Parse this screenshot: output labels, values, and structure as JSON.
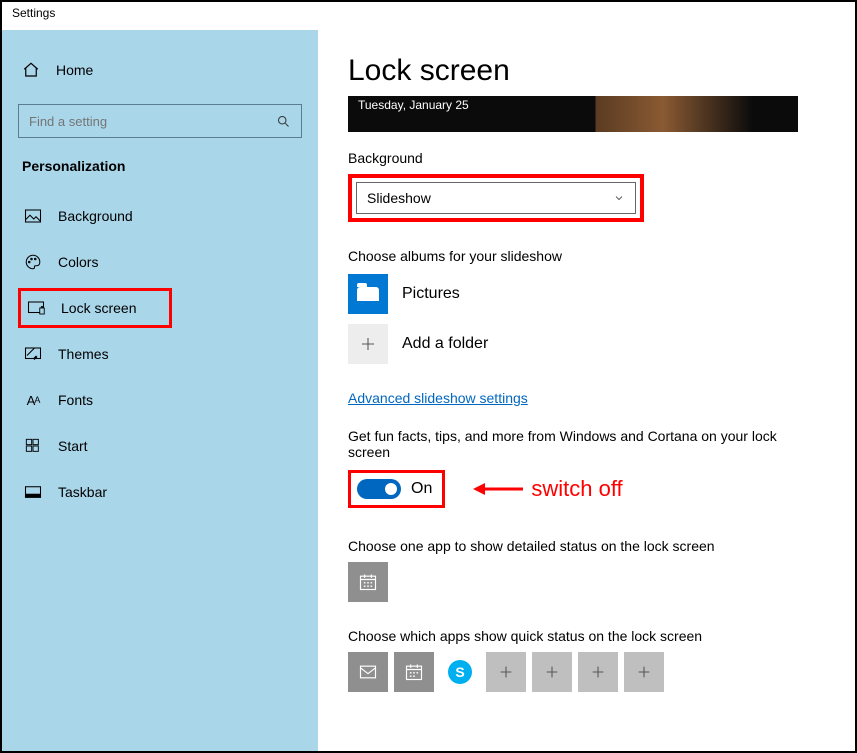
{
  "window": {
    "title": "Settings"
  },
  "sidebar": {
    "home": "Home",
    "search_placeholder": "Find a setting",
    "section": "Personalization",
    "items": [
      {
        "label": "Background"
      },
      {
        "label": "Colors"
      },
      {
        "label": "Lock screen"
      },
      {
        "label": "Themes"
      },
      {
        "label": "Fonts"
      },
      {
        "label": "Start"
      },
      {
        "label": "Taskbar"
      }
    ]
  },
  "main": {
    "title": "Lock screen",
    "preview_date": "Tuesday, January 25",
    "background_label": "Background",
    "background_value": "Slideshow",
    "albums_label": "Choose albums for your slideshow",
    "album_pictures": "Pictures",
    "add_folder": "Add a folder",
    "advanced_link": "Advanced slideshow settings",
    "fun_facts_label": "Get fun facts, tips, and more from Windows and Cortana on your lock screen",
    "toggle_state": "On",
    "annotation": "switch off",
    "detailed_label": "Choose one app to show detailed status on the lock screen",
    "quick_label": "Choose which apps show quick status on the lock screen"
  }
}
